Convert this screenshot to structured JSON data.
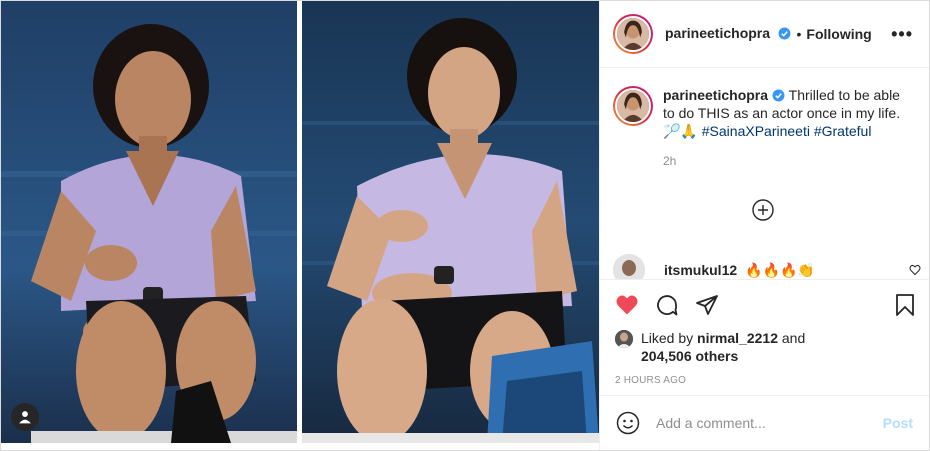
{
  "header": {
    "username": "parineetichopra",
    "separator": "•",
    "follow_state": "Following",
    "more_label": "•••",
    "verified_icon": "verified-badge-icon"
  },
  "caption": {
    "username": "parineetichopra",
    "text_before": "Thrilled to be able to do THIS as an actor once in my life.",
    "emojis": "🏸🙏",
    "hashtags": [
      "#SainaXParineeti",
      "#Grateful"
    ],
    "time": "2h"
  },
  "comments": [
    {
      "username": "itsmukul12",
      "text": "🔥🔥🔥👏"
    }
  ],
  "likes": {
    "prefix": "Liked by",
    "by_user": "nirmal_2212",
    "and": "and",
    "others": "204,506 others"
  },
  "post_time": "2 HOURS AGO",
  "add_comment": {
    "placeholder": "Add a comment...",
    "post_label": "Post"
  },
  "colors": {
    "like_red": "#ed4956",
    "link_blue": "#00376b",
    "verified_blue": "#3897f0",
    "post_disabled": "#b2dffc",
    "muted": "#8e8e8e"
  },
  "icons": [
    "heart-filled-icon",
    "comment-icon",
    "share-icon",
    "bookmark-icon",
    "emoji-icon",
    "plus-circle-icon",
    "heart-outline-icon",
    "user-tag-icon"
  ]
}
